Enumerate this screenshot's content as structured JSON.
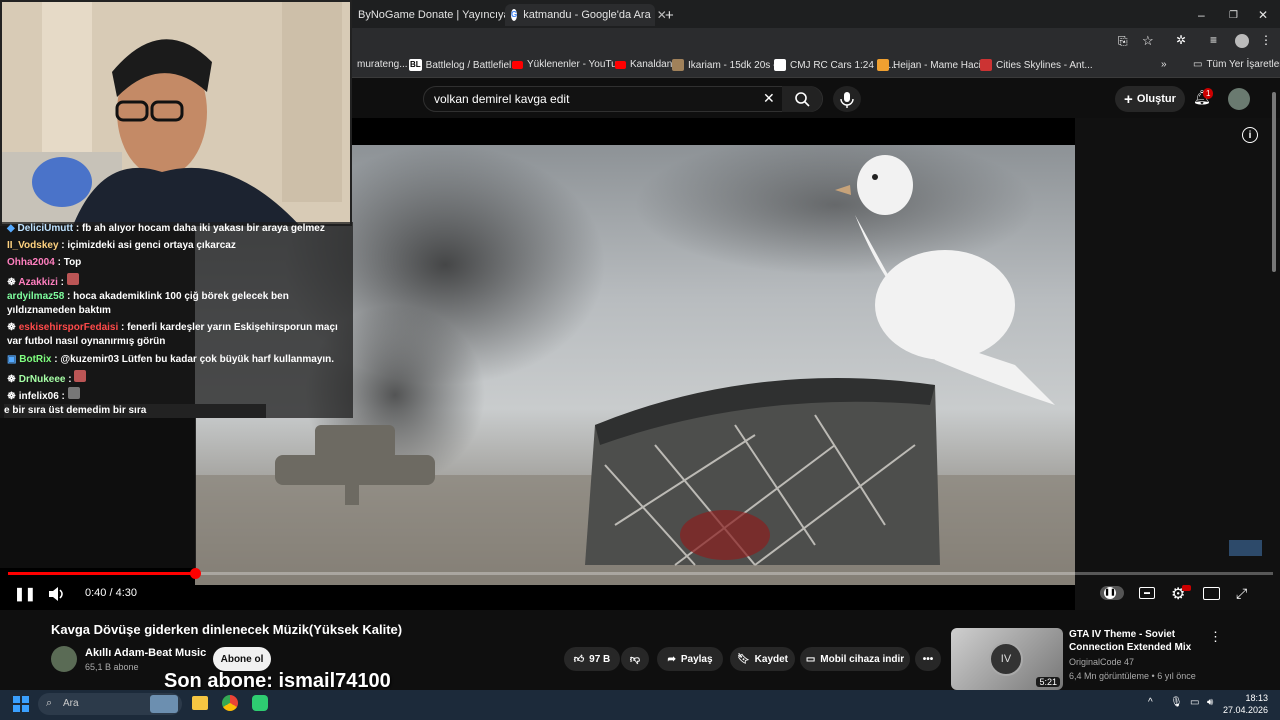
{
  "browser": {
    "tabs": [
      {
        "label": "ByNoGame Donate | Yayıncıya D"
      },
      {
        "label": "katmandu - Google'da Ara"
      }
    ],
    "bookmarks": [
      {
        "label": "murateng..."
      },
      {
        "label": "Battlelog / Battlefiel...",
        "icon": "BL"
      },
      {
        "label": "Yüklenenler - YouTu..."
      },
      {
        "label": "Kanaldan"
      },
      {
        "label": "Ikariam - 15dk 20s -..."
      },
      {
        "label": "CMJ RC Cars 1:24 Sc..."
      },
      {
        "label": "Heijan - Mame Haci..."
      },
      {
        "label": "Cities Skylines - Ant..."
      },
      {
        "label": "Tüm Yer İşaretleri"
      }
    ]
  },
  "youtube": {
    "search_value": "volkan demirel kavga edit",
    "create_label": "Oluştur",
    "notification_count": "1",
    "player": {
      "time": "0:40 / 4:30",
      "progress": 0.148
    },
    "video": {
      "title": "Kavga Dövüşe giderken dinlenecek Müzik(Yüksek Kalite)",
      "channel": "Akıllı Adam-Beat Music",
      "subscribers": "65,1 B abone",
      "subscribe_label": "Abone ol",
      "likes": "97 B",
      "share_label": "Paylaş",
      "save_label": "Kaydet",
      "download_label": "Mobil cihaza indir"
    },
    "recommendation": {
      "title": "GTA IV Theme - Soviet Connection Extended Mix",
      "channel": "OriginalCode 47",
      "meta": "6,4 Mn görüntüleme • 6 yıl önce",
      "duration": "5:21"
    }
  },
  "chat": [
    {
      "user": "DeliciUmutt",
      "text": "fb ah alıyor hocam daha iki yakası bir araya gelmez",
      "color": "#bfe3ff"
    },
    {
      "user": "II_Vodskey",
      "text": "içimizdeki asi genci ortaya çıkarcaz",
      "color": "#ffd27f"
    },
    {
      "user": "Ohha2004",
      "text": "Top",
      "color": "#ff7fbf"
    },
    {
      "user": "Azakkizi",
      "text": "",
      "color": "#ff7fbf"
    },
    {
      "user": "ardyilmaz58",
      "text": "hoca akademiklink 100 çiğ börek gelecek ben yıldıznameden baktım",
      "color": "#7fff9f"
    },
    {
      "user": "eskisehirsporFedaisi",
      "text": "fenerli kardeşler yarın Eskişehirsporun maçı var futbol nasıl oynanırmış görün",
      "color": "#ff4a4a"
    },
    {
      "user": "BotRix",
      "text": "@kuzemir03 Lütfen bu kadar çok büyük harf kullanmayın.",
      "color": "#7fff7f"
    },
    {
      "user": "DrNukeee",
      "text": "",
      "color": "#a6ffa6"
    },
    {
      "user": "infelix06",
      "text": "",
      "color": "#ffffff"
    },
    {
      "user": "",
      "text": "e bir sıra üst demedim bir sıra",
      "color": "#ffffff"
    }
  ],
  "overlay_text": "Son abone: ismail74100",
  "taskbar": {
    "search_placeholder": "Ara",
    "time": "18:13",
    "date": "27.04.2026"
  }
}
